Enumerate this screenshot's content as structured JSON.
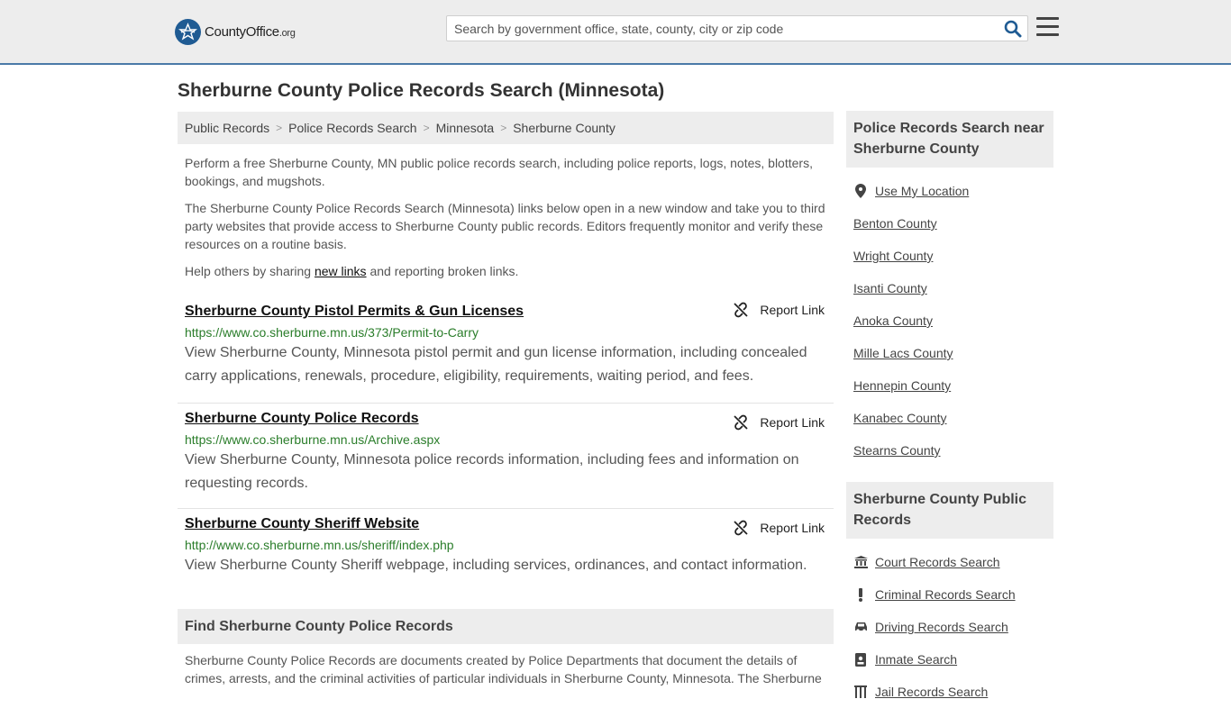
{
  "header": {
    "logo_main": "CountyOffice",
    "logo_suffix": ".org",
    "search_placeholder": "Search by government office, state, county, city or zip code",
    "search_icon": "search-icon",
    "menu_icon": "hamburger-menu-icon"
  },
  "page_title": "Sherburne County Police Records Search (Minnesota)",
  "breadcrumb": [
    "Public Records",
    "Police Records Search",
    "Minnesota",
    "Sherburne County"
  ],
  "intro": {
    "p1": "Perform a free Sherburne County, MN public police records search, including police reports, logs, notes, blotters, bookings, and mugshots.",
    "p2": "The Sherburne County Police Records Search (Minnesota) links below open in a new window and take you to third party websites that provide access to Sherburne County public records. Editors frequently monitor and verify these resources on a routine basis.",
    "p3_before": "Help others by sharing ",
    "p3_link": "new links",
    "p3_after": " and reporting broken links."
  },
  "report_label": "Report Link",
  "results": [
    {
      "title": "Sherburne County Pistol Permits & Gun Licenses",
      "url": "https://www.co.sherburne.mn.us/373/Permit-to-Carry",
      "desc": "View Sherburne County, Minnesota pistol permit and gun license information, including concealed carry applications, renewals, procedure, eligibility, requirements, waiting period, and fees."
    },
    {
      "title": "Sherburne County Police Records",
      "url": "https://www.co.sherburne.mn.us/Archive.aspx",
      "desc": "View Sherburne County, Minnesota police records information, including fees and information on requesting records."
    },
    {
      "title": "Sherburne County Sheriff Website",
      "url": "http://www.co.sherburne.mn.us/sheriff/index.php",
      "desc": "View Sherburne County Sheriff webpage, including services, ordinances, and contact information."
    }
  ],
  "find_section": {
    "heading": "Find Sherburne County Police Records",
    "text": "Sherburne County Police Records are documents created by Police Departments that document the details of crimes, arrests, and the criminal activities of particular individuals in Sherburne County, Minnesota. The Sherburne"
  },
  "sidebar": {
    "nearby_heading": "Police Records Search near Sherburne County",
    "use_location": "Use My Location",
    "nearby": [
      "Benton County",
      "Wright County",
      "Isanti County",
      "Anoka County",
      "Mille Lacs County",
      "Hennepin County",
      "Kanabec County",
      "Stearns County"
    ],
    "public_heading": "Sherburne County Public Records",
    "public_links": [
      {
        "label": "Court Records Search",
        "icon": "courthouse-icon"
      },
      {
        "label": "Criminal Records Search",
        "icon": "exclamation-icon"
      },
      {
        "label": "Driving Records Search",
        "icon": "car-icon"
      },
      {
        "label": "Inmate Search",
        "icon": "id-badge-icon"
      },
      {
        "label": "Jail Records Search",
        "icon": "jail-icon"
      }
    ]
  },
  "colors": {
    "header_bg": "#ededed",
    "header_border": "#4a7aa8",
    "logo_blue": "#1f5b93",
    "url_green": "#2a7d2a",
    "search_icon_blue": "#1f5b93"
  }
}
